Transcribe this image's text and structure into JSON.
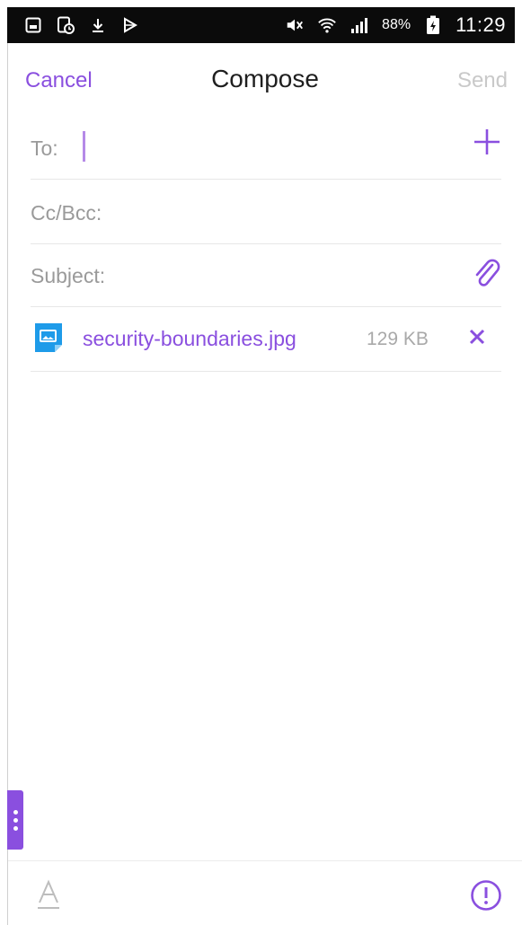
{
  "status_bar": {
    "battery_percent": "88%",
    "time": "11:29",
    "icons": [
      "gallery-icon",
      "phone-sync-icon",
      "download-icon",
      "play-store-icon",
      "mute-icon",
      "wifi-icon",
      "signal-icon",
      "battery-icon"
    ]
  },
  "header": {
    "cancel_label": "Cancel",
    "title": "Compose",
    "send_label": "Send"
  },
  "fields": {
    "to_label": "To:",
    "cc_bcc_label": "Cc/Bcc:",
    "subject_label": "Subject:"
  },
  "attachment": {
    "file_name": "security-boundaries.jpg",
    "file_size": "129 KB"
  },
  "colors": {
    "accent": "#8a4fdf",
    "disabled": "#c9c9c9",
    "label": "#9a9a9a"
  }
}
